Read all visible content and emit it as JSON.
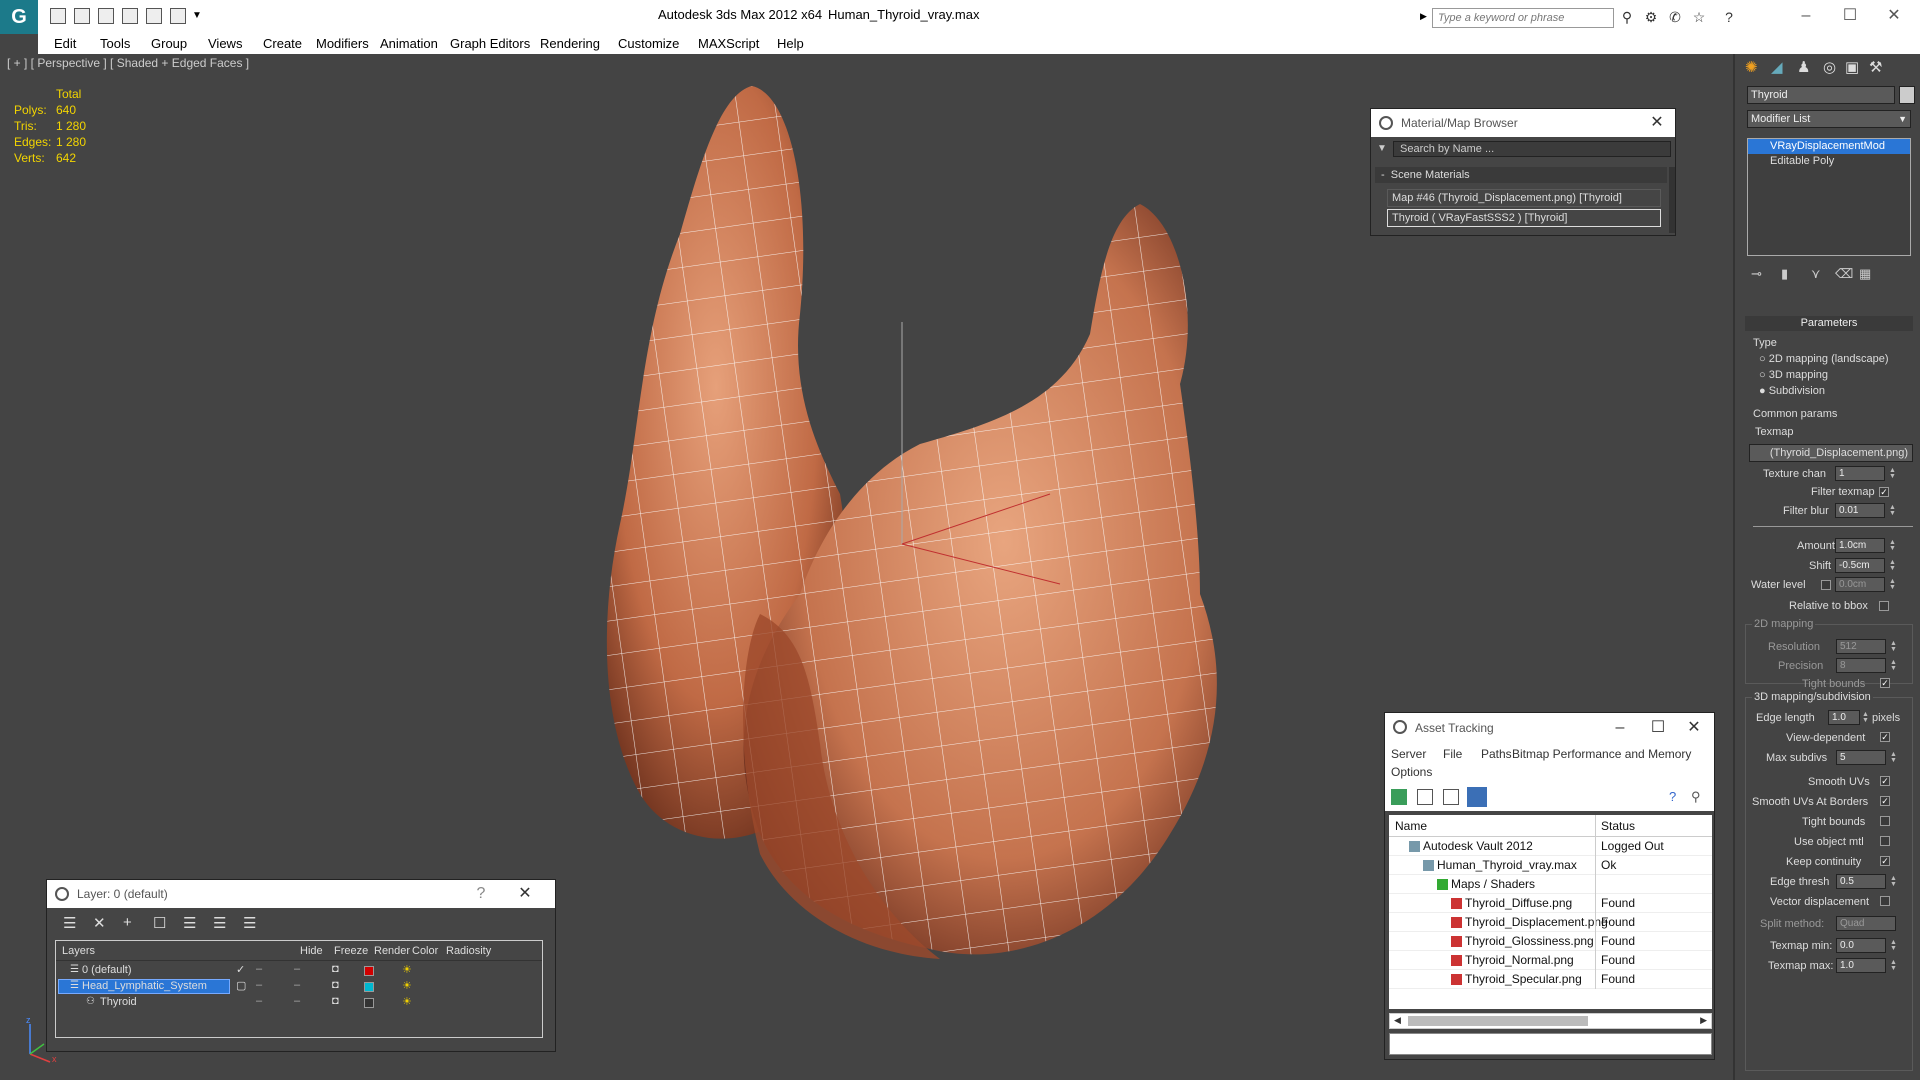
{
  "app": {
    "title": "Autodesk 3ds Max  2012 x64",
    "file": "Human_Thyroid_vray.max",
    "search_placeholder": "Type a keyword or phrase",
    "logo": "3ds-max-logo"
  },
  "menu": [
    "Edit",
    "Tools",
    "Group",
    "Views",
    "Create",
    "Modifiers",
    "Animation",
    "Graph Editors",
    "Rendering",
    "Customize",
    "MAXScript",
    "Help"
  ],
  "viewport": {
    "label": "[ + ] [ Perspective ] [ Shaded + Edged Faces ]",
    "stats_header": "Total",
    "stats": [
      {
        "k": "Polys:",
        "v": "640"
      },
      {
        "k": "Tris:",
        "v": "1 280"
      },
      {
        "k": "Edges:",
        "v": "1 280"
      },
      {
        "k": "Verts:",
        "v": "642"
      }
    ],
    "gizmo": [
      "x",
      "y",
      "z"
    ]
  },
  "material_browser": {
    "title": "Material/Map Browser",
    "search": "Search by Name ...",
    "section": "Scene Materials",
    "items": [
      "Map #46 (Thyroid_Displacement.png)  [Thyroid]",
      "Thyroid  ( VRayFastSSS2 )  [Thyroid]"
    ]
  },
  "asset_tracking": {
    "title": "Asset Tracking",
    "menu": [
      "Server",
      "File",
      "Paths",
      "Bitmap Performance and Memory",
      "Options"
    ],
    "columns": [
      "Name",
      "Status"
    ],
    "rows": [
      {
        "name": "Autodesk Vault 2012",
        "status": "Logged Out",
        "indent": 0
      },
      {
        "name": "Human_Thyroid_vray.max",
        "status": "Ok",
        "indent": 1
      },
      {
        "name": "Maps / Shaders",
        "status": "",
        "indent": 2
      },
      {
        "name": "Thyroid_Diffuse.png",
        "status": "Found",
        "indent": 3
      },
      {
        "name": "Thyroid_Displacement.png",
        "status": "Found",
        "indent": 3
      },
      {
        "name": "Thyroid_Glossiness.png",
        "status": "Found",
        "indent": 3
      },
      {
        "name": "Thyroid_Normal.png",
        "status": "Found",
        "indent": 3
      },
      {
        "name": "Thyroid_Specular.png",
        "status": "Found",
        "indent": 3
      }
    ]
  },
  "layer_window": {
    "title": "Layer: 0 (default)",
    "help": "?",
    "columns": [
      "Layers",
      "Hide",
      "Freeze",
      "Render",
      "Color",
      "Radiosity"
    ],
    "rows": [
      {
        "name": "0 (default)",
        "color": "#d00000",
        "selected": false,
        "checked": true
      },
      {
        "name": "Head_Lymphatic_System",
        "color": "#00b8d0",
        "selected": true,
        "checked": false
      },
      {
        "name": "Thyroid",
        "color": "#333333",
        "selected": false,
        "checked": false
      }
    ]
  },
  "command_panel": {
    "object_name": "Thyroid",
    "modifier_list": "Modifier List",
    "stack": [
      "VRayDisplacementMod",
      "Editable Poly"
    ],
    "rollout": "Parameters",
    "type_label": "Type",
    "type_options": [
      "2D mapping (landscape)",
      "3D mapping",
      "Subdivision"
    ],
    "type_selected": "Subdivision",
    "common_label": "Common params",
    "texmap_label": "Texmap",
    "texmap_value": "(Thyroid_Displacement.png)",
    "texture_chan_label": "Texture chan",
    "texture_chan": "1",
    "filter_texmap_label": "Filter texmap",
    "filter_blur_label": "Filter blur",
    "filter_blur": "0.01",
    "amount_label": "Amount",
    "amount": "1.0cm",
    "shift_label": "Shift",
    "shift": "-0.5cm",
    "water_label": "Water level",
    "water": "0.0cm",
    "relbbox_label": "Relative to bbox",
    "map2d_label": "2D mapping",
    "resolution_label": "Resolution",
    "resolution": "512",
    "precision_label": "Precision",
    "precision": "8",
    "tight_label": "Tight bounds",
    "map3d_label": "3D mapping/subdivision",
    "edge_label": "Edge length",
    "edge": "1.0",
    "pixels": "pixels",
    "viewdep_label": "View-dependent",
    "maxsub_label": "Max subdivs",
    "maxsub": "5",
    "smoothuv_label": "Smooth UVs",
    "smoothuvb_label": "Smooth UVs At Borders",
    "tight2_label": "Tight bounds",
    "useobj_label": "Use object mtl",
    "keepc_label": "Keep continuity",
    "edgethresh_label": "Edge thresh",
    "edgethresh": "0.5",
    "vecdisp_label": "Vector displacement",
    "split_label": "Split method:",
    "split": "Quad",
    "texmin_label": "Texmap min:",
    "texmin": "0.0",
    "texmax_label": "Texmap max:",
    "texmax": "1.0"
  },
  "colors": {
    "flesh_light": "#d9906a",
    "flesh_dark": "#7a3520",
    "wire": "#ffffff",
    "accent": "#2a76d6"
  }
}
